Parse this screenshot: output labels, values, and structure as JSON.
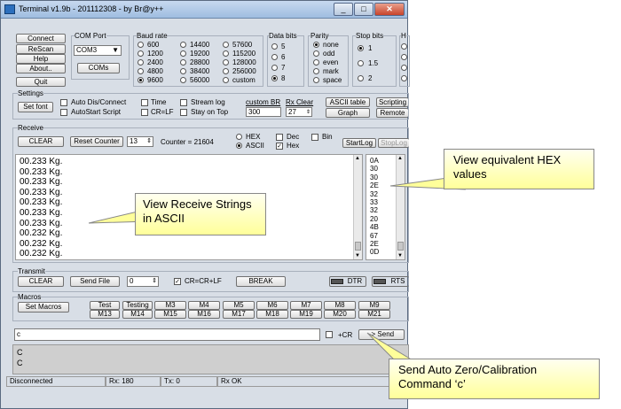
{
  "window": {
    "title": "Terminal v1.9b - 201112308 - by Br@y++",
    "minimize": "_",
    "maximize": "□",
    "close": "✕"
  },
  "connection": {
    "connect": "Connect",
    "rescan": "ReScan",
    "help": "Help",
    "about": "About..",
    "quit": "Quit"
  },
  "com_port": {
    "label": "COM Port",
    "value": "COM3",
    "coms_button": "COMs"
  },
  "baud": {
    "label": "Baud rate",
    "options": [
      "600",
      "1200",
      "2400",
      "4800",
      "9600",
      "14400",
      "19200",
      "28800",
      "38400",
      "56000",
      "57600",
      "115200",
      "128000",
      "256000",
      "custom"
    ],
    "selected": "9600"
  },
  "data_bits": {
    "label": "Data bits",
    "options": [
      "5",
      "6",
      "7",
      "8"
    ],
    "selected": "8"
  },
  "parity": {
    "label": "Parity",
    "options": [
      "none",
      "odd",
      "even",
      "mark",
      "space"
    ],
    "selected": "none"
  },
  "stop_bits": {
    "label": "Stop bits",
    "options": [
      "1",
      "1.5",
      "2"
    ],
    "selected": "1"
  },
  "handshaking": {
    "label": "H"
  },
  "settings": {
    "label": "Settings",
    "set_font": "Set font",
    "auto_dis": "Auto Dis/Connect",
    "autostart": "AutoStart Script",
    "time": "Time",
    "crlf": "CR=LF",
    "stream_log": "Stream log",
    "stay_on_top": "Stay on Top",
    "custom_br_label": "custom BR",
    "custom_br_value": "300",
    "rx_clear_label": "Rx Clear",
    "rx_clear_value": "27",
    "ascii_table": "ASCII table",
    "graph": "Graph",
    "scripting": "Scripting",
    "remote": "Remote"
  },
  "receive": {
    "label": "Receive",
    "clear": "CLEAR",
    "reset_counter": "Reset Counter",
    "count_value": "13",
    "counter": "Counter = 21604",
    "hex": "HEX",
    "ascii": "ASCII",
    "dec": "Dec",
    "hex_chk": "Hex",
    "bin": "Bin",
    "startlog": "StartLog",
    "stoplog": "StopLog",
    "lines": [
      "00.233 Kg.",
      "00.233 Kg.",
      "00.233 Kg.",
      "00.233 Kg.",
      "00.233 Kg.",
      "00.233 Kg.",
      "00.233 Kg.",
      "00.232 Kg.",
      "00.232 Kg.",
      "00.232 Kg."
    ],
    "hex_values": [
      "0A",
      "30",
      "30",
      "2E",
      "32",
      "33",
      "32",
      "20",
      "4B",
      "67",
      "2E",
      "0D"
    ]
  },
  "transmit": {
    "label": "Transmit",
    "clear": "CLEAR",
    "send_file": "Send File",
    "file_value": "0",
    "cr_crlf": "CR=CR+LF",
    "break": "BREAK",
    "dtr": "DTR",
    "rts": "RTS"
  },
  "macros": {
    "label": "Macros",
    "set_macros": "Set Macros",
    "row1": [
      "Test",
      "Testing",
      "M3",
      "M4",
      "M5",
      "M6",
      "M7",
      "M8",
      "M9"
    ],
    "row2": [
      "M13",
      "M14",
      "M15",
      "M16",
      "M17",
      "M18",
      "M19",
      "M20",
      "M21"
    ]
  },
  "send": {
    "input_value": "c",
    "plus_cr": "+CR",
    "send_button": "-> Send"
  },
  "transmit_log": {
    "lines": [
      "C",
      "C"
    ]
  },
  "statusbar": {
    "connection": "Disconnected",
    "rx": "Rx: 180",
    "tx": "Tx: 0",
    "rx_ok": "Rx OK"
  },
  "callouts": {
    "receive_ascii": "View Receive Strings in ASCII",
    "hex": "View equivalent HEX values",
    "send": "Send Auto Zero/Calibration Command ‘c’"
  }
}
